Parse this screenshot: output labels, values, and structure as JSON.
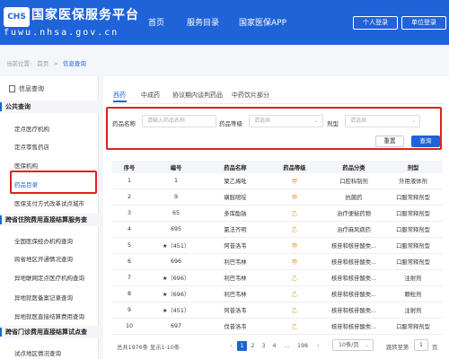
{
  "header": {
    "logo_badge": "CHS",
    "title": "国家医保服务平台",
    "url": "fuwu.nhsa.gov.cn",
    "nav": [
      "首页",
      "服务目录",
      "国家医保APP"
    ],
    "btn_personal": "个人登录",
    "btn_unit": "单位登录"
  },
  "breadcrumb": {
    "prefix": "当前位置:",
    "home": "首页",
    "current": "信息查询"
  },
  "sidebar": {
    "heading": "信息查询",
    "sections": [
      {
        "title": "公共查询",
        "items": [
          "定点医疗机构",
          "定点零售药店",
          "医保机构",
          "药品目录",
          "医保支付方式改革试点城市"
        ]
      },
      {
        "title": "跨省住院费用直接结算服务查",
        "items": [
          "全国医保经办机构查询",
          "跨省地区开通情况查询",
          "异地联网定点医疗机构查询",
          "异地就医备案记录查询",
          "异地就医直接结算费用查询"
        ]
      },
      {
        "title": "跨省门诊费用直接结算试点查",
        "items": [
          "试点地区情况查询"
        ]
      }
    ],
    "active_item": "药品目录"
  },
  "tabs": [
    "西药",
    "中成药",
    "协议期内谈判药品",
    "中药饮片部分"
  ],
  "active_tab": "西药",
  "search": {
    "name_label": "药品名称",
    "name_placeholder": "请输入药品名称",
    "level_label": "药品等级",
    "level_placeholder": "请选择",
    "form_label": "剂型",
    "form_placeholder": "请选择",
    "reset": "重置",
    "query": "查询"
  },
  "table": {
    "columns": [
      "序号",
      "编号",
      "药品名称",
      "药品等级",
      "药品分类",
      "剂型"
    ],
    "rows": [
      [
        "1",
        "1",
        "聚乙烯吡",
        "甲",
        "口腔科制剂",
        "外用液体剂"
      ],
      [
        "2",
        "9",
        "磺胺嘧啶",
        "甲",
        "抗菌药",
        "口服常释剂型"
      ],
      [
        "3",
        "65",
        "多库酯钠",
        "乙",
        "治疗便秘药物",
        "口服常释剂型"
      ],
      [
        "4",
        "695",
        "氯法齐明",
        "乙",
        "治疗麻风病药",
        "口服常释剂型"
      ],
      [
        "5",
        "★（451）",
        "阿昔洛韦",
        "甲",
        "核苷和核苷酸类...",
        "口服常释剂型"
      ],
      [
        "6",
        "696",
        "利巴韦林",
        "甲",
        "核苷和核苷酸类...",
        "口服常释剂型"
      ],
      [
        "7",
        "★（696）",
        "利巴韦林",
        "乙",
        "核苷和核苷酸类...",
        "注射剂"
      ],
      [
        "8",
        "★（696）",
        "利巴韦林",
        "乙",
        "核苷和核苷酸类...",
        "颗粒剂"
      ],
      [
        "9",
        "★（451）",
        "阿昔洛韦",
        "乙",
        "核苷和核苷酸类...",
        "注射剂"
      ],
      [
        "10",
        "697",
        "伐昔洛韦",
        "乙",
        "核苷和核苷酸类...",
        "口服常释剂型"
      ]
    ]
  },
  "pager": {
    "total": "总共1976条 显示1-10条",
    "pages": [
      "1",
      "2",
      "3",
      "4"
    ],
    "ellipsis": "...",
    "last": "198",
    "prev": "‹",
    "next": "›",
    "page_size": "10条/页",
    "goto": "跳转至第",
    "goto_value": "1",
    "page_suffix": "页"
  },
  "colors": {
    "brand": "#1f63d8",
    "highlight": "#e02020",
    "level": "#e8952e"
  }
}
